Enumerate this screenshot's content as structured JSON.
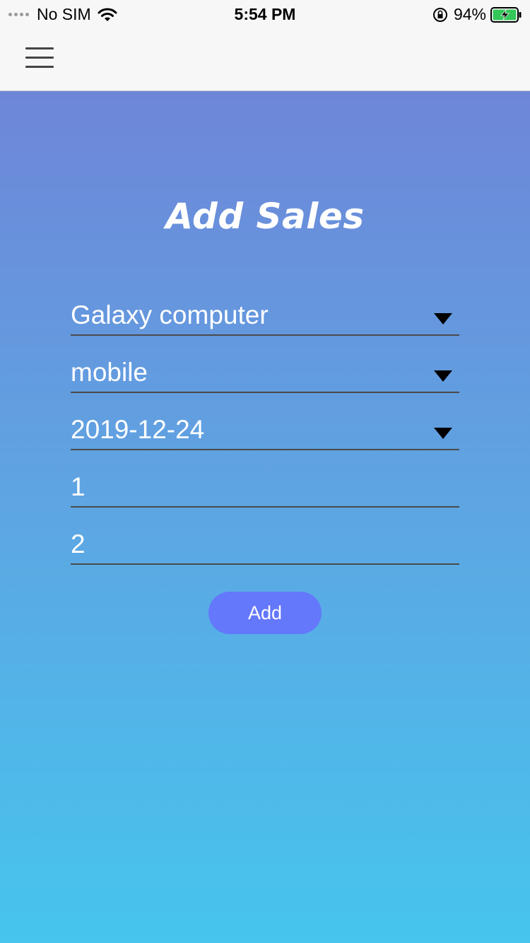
{
  "status_bar": {
    "carrier": "No SIM",
    "time": "5:54 PM",
    "battery_percent": "94%",
    "battery_level": 0.94,
    "icons": [
      "signal-dots-icon",
      "wifi-icon",
      "orientation-lock-icon",
      "battery-charging-icon"
    ]
  },
  "nav": {
    "menu_icon": "hamburger-menu-icon"
  },
  "page": {
    "title": "Add Sales",
    "gradient_top": "#6e86d8",
    "gradient_bottom": "#46c5ee"
  },
  "form": {
    "store_select": {
      "value": "Galaxy computer",
      "icon": "caret-down-icon"
    },
    "product_select": {
      "value": "mobile",
      "icon": "caret-down-icon"
    },
    "date_select": {
      "value": "2019-12-24",
      "icon": "caret-down-icon"
    },
    "quantity_input": {
      "value": "1"
    },
    "price_input": {
      "value": "2"
    },
    "submit_label": "Add",
    "submit_color": "#6478fb"
  }
}
